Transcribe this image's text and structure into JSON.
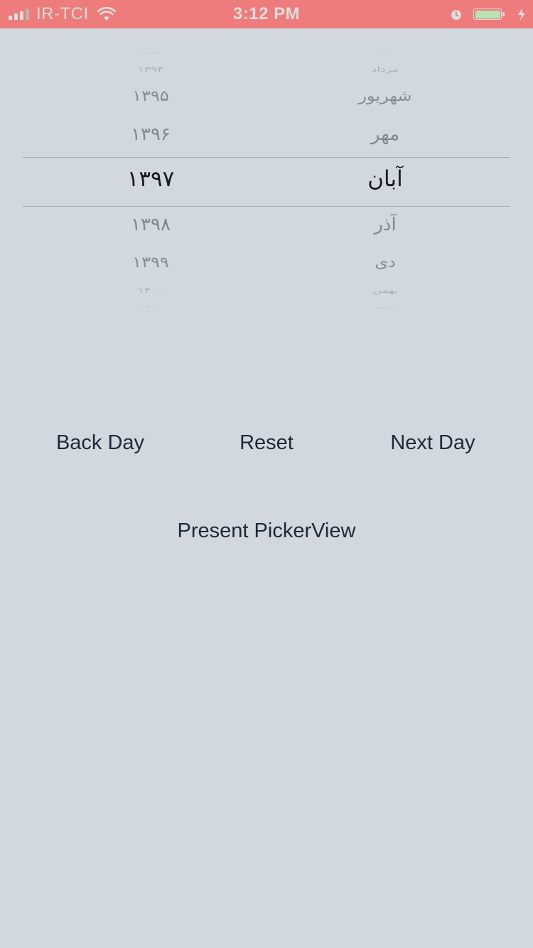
{
  "status_bar": {
    "carrier": "IR-TCI",
    "time": "3:12 PM",
    "icons": [
      "signal-icon",
      "wifi-icon",
      "alarm-icon",
      "battery-icon",
      "charging-bolt-icon"
    ],
    "battery_color": "#b9e3b1",
    "bar_color": "#ee7c7c"
  },
  "picker": {
    "year_column": {
      "items": [
        "۱۳۹۳",
        "۱۳۹۴",
        "۱۳۹۵",
        "۱۳۹۶",
        "۱۳۹۷",
        "۱۳۹۸",
        "۱۳۹۹",
        "۱۴۰۰",
        "۱۴۰۱"
      ],
      "selected": "۱۳۹۷"
    },
    "month_column": {
      "items": [
        "تیر",
        "مرداد",
        "شهریور",
        "مهر",
        "آبان",
        "آذر",
        "دی",
        "بهمن",
        "اسفند"
      ],
      "selected": "آبان"
    }
  },
  "buttons": {
    "back_day": "Back Day",
    "reset": "Reset",
    "next_day": "Next Day",
    "present_picker": "Present PickerView"
  },
  "colors": {
    "background": "#d1d8df",
    "button_text": "#1c2a3a",
    "selected_text": "#1a1a1a",
    "faded_text": "#7b7f82"
  }
}
